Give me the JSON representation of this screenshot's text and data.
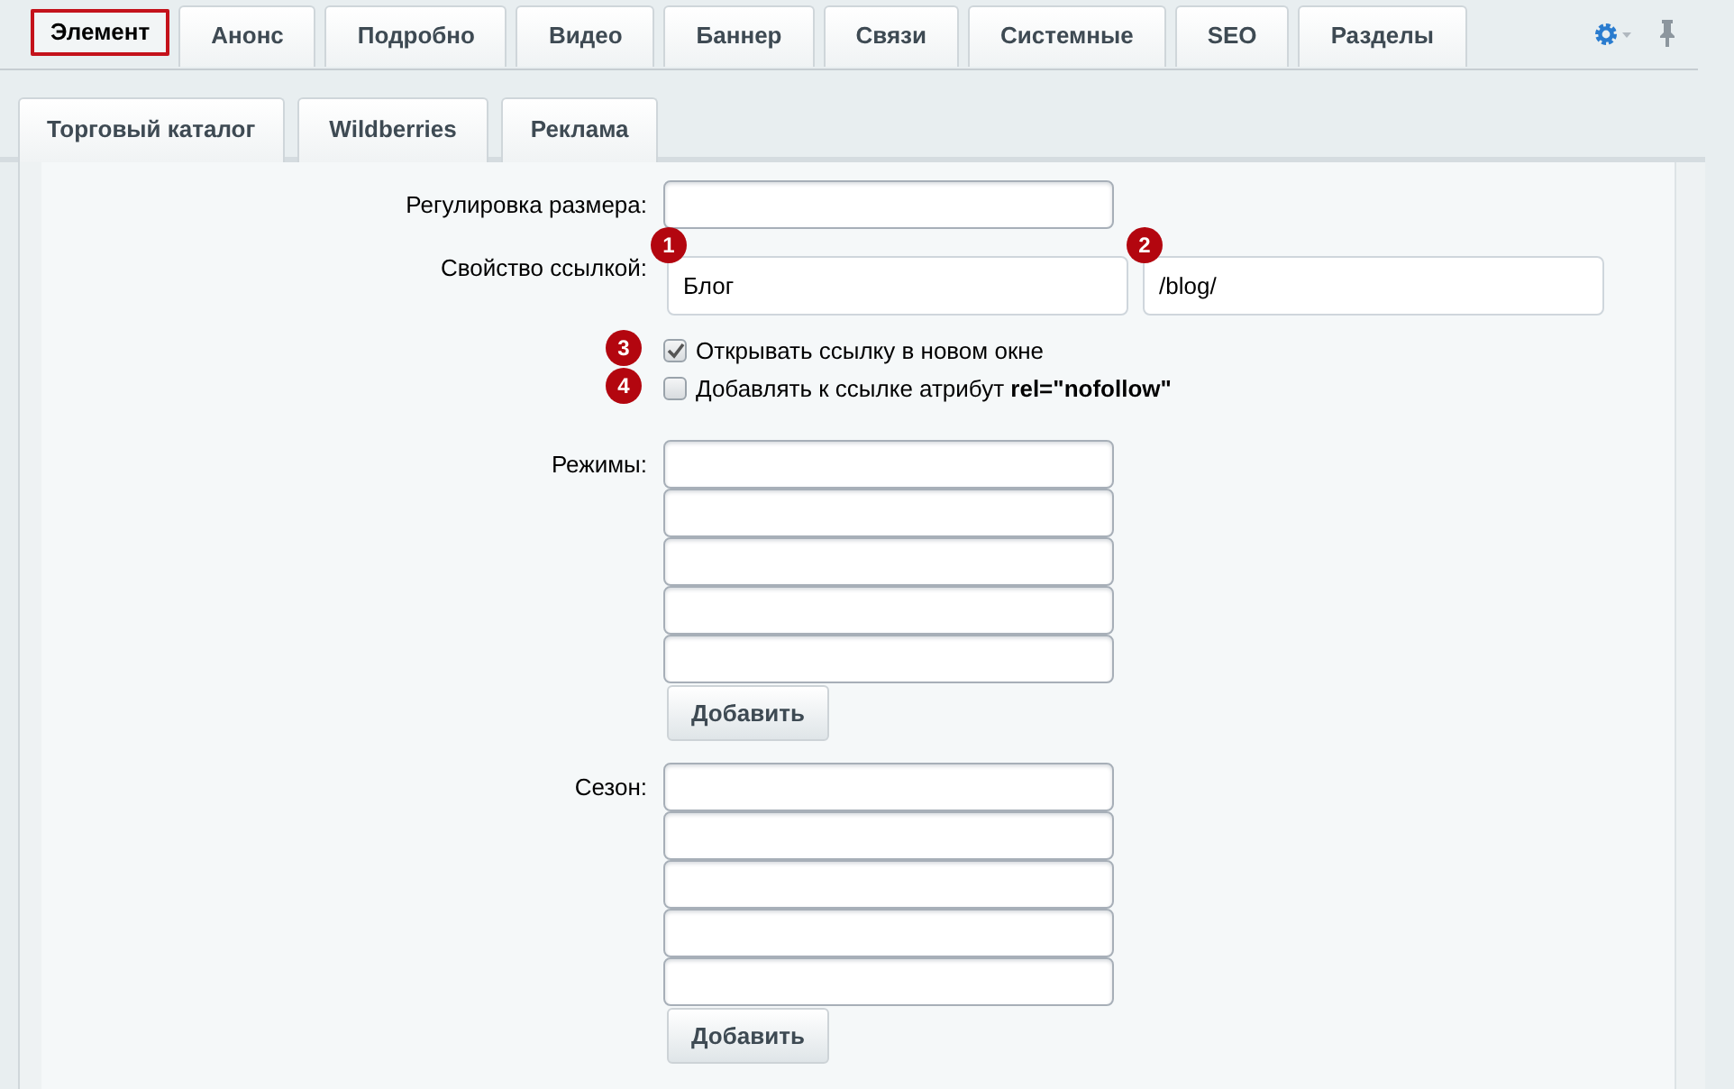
{
  "tabs": [
    {
      "label": "Элемент",
      "selected": true
    },
    {
      "label": "Анонс",
      "selected": false
    },
    {
      "label": "Подробно",
      "selected": false
    },
    {
      "label": "Видео",
      "selected": false
    },
    {
      "label": "Баннер",
      "selected": false
    },
    {
      "label": "Связи",
      "selected": false
    },
    {
      "label": "Системные",
      "selected": false
    },
    {
      "label": "SEO",
      "selected": false
    },
    {
      "label": "Разделы",
      "selected": false
    }
  ],
  "subtabs": [
    {
      "label": "Торговый каталог",
      "selected": false
    },
    {
      "label": "Wildberries",
      "selected": false
    },
    {
      "label": "Реклама",
      "selected": false
    }
  ],
  "form": [
    {
      "kind": "text",
      "label": "Регулировка размера:"
    },
    {
      "kind": "link",
      "label": "Свойство ссылкой:",
      "inputs": [
        {
          "value": "Блог",
          "marker": "1"
        },
        {
          "value": "/blog/",
          "marker": "2"
        }
      ]
    },
    {
      "kind": "checkbox",
      "label": "Открывать ссылку в новом окне",
      "checked": true,
      "marker": "3"
    },
    {
      "kind": "checkbox",
      "label": "Добавлять к ссылке атрибут **rel=\"nofollow\"**",
      "checked": false,
      "marker": "4"
    },
    {
      "kind": "multi",
      "label": "Режимы:",
      "inputs": [
        {
          "kind": "text"
        },
        {
          "kind": "text"
        },
        {
          "kind": "text"
        },
        {
          "kind": "text"
        },
        {
          "kind": "text"
        }
      ],
      "button": "Добавить"
    },
    {
      "kind": "multi",
      "label": "Сезон:",
      "inputs": [
        {
          "kind": "text"
        },
        {
          "kind": "text"
        },
        {
          "kind": "text"
        },
        {
          "kind": "text"
        },
        {
          "kind": "text"
        }
      ],
      "button": "Добавить"
    }
  ]
}
